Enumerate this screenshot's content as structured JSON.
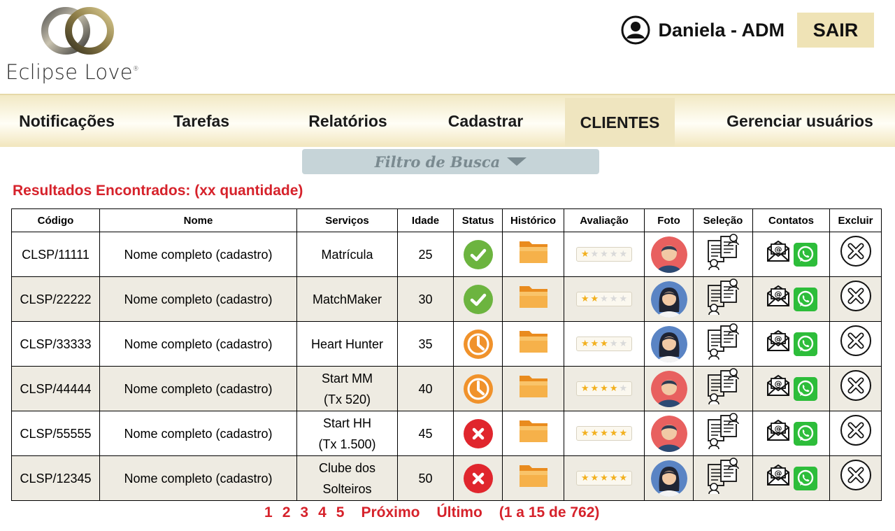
{
  "brand": {
    "name": "Eclipse Love",
    "registered_mark": "®"
  },
  "user": {
    "display_name": "Daniela - ADM",
    "logout_label": "SAIR"
  },
  "nav": {
    "items": [
      {
        "label": "Notificações"
      },
      {
        "label": "Tarefas"
      },
      {
        "label": "Relatórios"
      },
      {
        "label": "Cadastrar"
      },
      {
        "label": "CLIENTES",
        "active": true
      },
      {
        "label": "Gerenciar usuários"
      }
    ]
  },
  "filter": {
    "label": "Filtro de Busca"
  },
  "results": {
    "title": "Resultados Encontrados: (xx quantidade)",
    "columns": [
      "Código",
      "Nome",
      "Serviços",
      "Idade",
      "Status",
      "Histórico",
      "Avaliação",
      "Foto",
      "Seleção",
      "Contatos",
      "Excluir"
    ],
    "rows": [
      {
        "code": "CLSP/11111",
        "name": "Nome completo (cadastro)",
        "service_line1": "Matrícula",
        "service_line2": "",
        "age": "25",
        "status": "approved",
        "rating": 1,
        "photo": "male"
      },
      {
        "code": "CLSP/22222",
        "name": "Nome completo (cadastro)",
        "service_line1": "MatchMaker",
        "service_line2": "",
        "age": "30",
        "status": "approved",
        "rating": 2,
        "photo": "female"
      },
      {
        "code": "CLSP/33333",
        "name": "Nome completo (cadastro)",
        "service_line1": "Heart Hunter",
        "service_line2": "",
        "age": "35",
        "status": "pending",
        "rating": 3,
        "photo": "female"
      },
      {
        "code": "CLSP/44444",
        "name": "Nome completo (cadastro)",
        "service_line1": "Start MM",
        "service_line2": "(Tx 520)",
        "age": "40",
        "status": "pending",
        "rating": 4,
        "photo": "male"
      },
      {
        "code": "CLSP/55555",
        "name": "Nome completo (cadastro)",
        "service_line1": "Start HH",
        "service_line2": "(Tx 1.500)",
        "age": "45",
        "status": "rejected",
        "rating": 5,
        "photo": "male"
      },
      {
        "code": "CLSP/12345",
        "name": "Nome completo (cadastro)",
        "service_line1": "Clube dos",
        "service_line2": "Solteiros",
        "age": "50",
        "status": "rejected",
        "rating": 5,
        "photo": "female"
      }
    ]
  },
  "pagination": {
    "pages": [
      "1",
      "2",
      "3",
      "4",
      "5"
    ],
    "next_label": "Próximo",
    "last_label": "Último",
    "summary": "(1 a 15 de 762)"
  },
  "colors": {
    "accent_red": "#d6222b",
    "nav_gold": "#efe3b6",
    "status_approved": "#6cb43f",
    "status_pending": "#f0922b",
    "status_rejected": "#e0262d",
    "whatsapp": "#2dbd3a",
    "filter_bg": "#c6d4d8"
  },
  "icons": {
    "status_approved": "check-circle-icon",
    "status_pending": "clock-icon",
    "status_rejected": "x-circle-icon",
    "history": "folder-icon",
    "selection": "contact-card-icon",
    "email": "mail-icon",
    "whatsapp": "whatsapp-icon",
    "delete": "delete-circle-icon"
  }
}
